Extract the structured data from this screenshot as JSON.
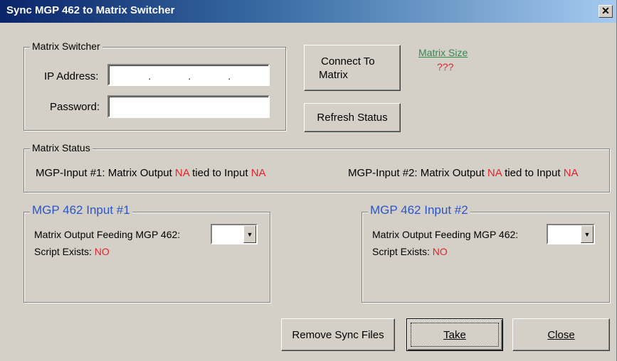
{
  "window": {
    "title": "Sync MGP 462 to Matrix Switcher",
    "close_glyph": "✕"
  },
  "matrix_switcher": {
    "legend": "Matrix Switcher",
    "ip_label": "IP Address:",
    "ip_value": "",
    "password_label": "Password:",
    "password_value": ""
  },
  "buttons": {
    "connect_line1": "Connect To",
    "connect_line2": "Matrix",
    "refresh": "Refresh Status",
    "remove_sync": "Remove Sync Files",
    "take": "Take",
    "close": "Close"
  },
  "matrix_size": {
    "label": "Matrix Size",
    "value": "???"
  },
  "matrix_status": {
    "legend": "Matrix Status",
    "input1_prefix": "MGP-Input #1: Matrix Output",
    "input1_output": "NA",
    "input1_mid": "tied to Input",
    "input1_input": "NA",
    "input2_prefix": "MGP-Input #2: Matrix Output",
    "input2_output": "NA",
    "input2_mid": "tied to Input",
    "input2_input": "NA"
  },
  "input1": {
    "legend": "MGP 462 Input #1",
    "feeding_label": "Matrix Output Feeding MGP 462:",
    "feeding_value": "",
    "script_label": "Script Exists:",
    "script_value": "NO"
  },
  "input2": {
    "legend": "MGP 462 Input #2",
    "feeding_label": "Matrix Output Feeding MGP 462:",
    "feeding_value": "",
    "script_label": "Script Exists:",
    "script_value": "NO"
  },
  "colors": {
    "title_gradient_start": "#0a246a",
    "dialog_bg": "#d4d0c8",
    "status_red": "#e0242d",
    "link_green": "#2f8a4d",
    "legend_blue": "#2b55c8"
  },
  "icons": {
    "dropdown_arrow": "chevron-down-icon",
    "close": "close-icon"
  }
}
